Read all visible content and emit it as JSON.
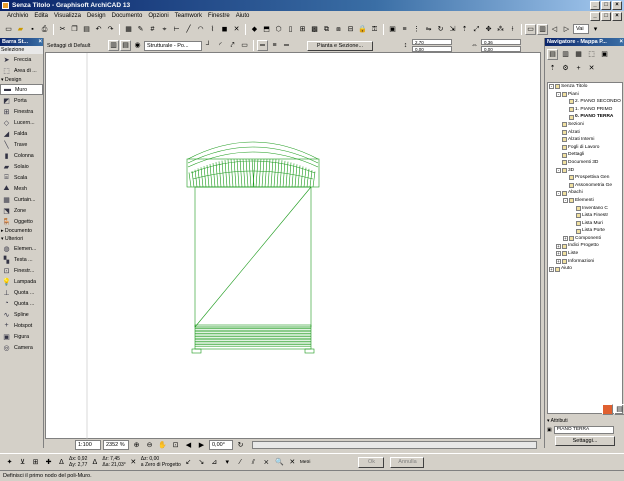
{
  "window": {
    "title": "Senza Titolo - Graphisoft ArchiCAD 13"
  },
  "menu": [
    "Archivio",
    "Edita",
    "Visualizza",
    "Design",
    "Documento",
    "Opzioni",
    "Teamwork",
    "Finestre",
    "Aiuto"
  ],
  "infobox": {
    "settings_label": "Settaggi di Default",
    "structure_select": "Strutturale - Po...",
    "plan_section_button": "Pianta e Sezione...",
    "val_1": "2,70",
    "val_2": "0,00",
    "val_3": "0,36",
    "val_4": "0,00",
    "layer_value": "Vai"
  },
  "toolbox": {
    "title": "Barra St...",
    "selection_label": "Selezione",
    "tools_top": [
      "Freccia",
      "Area di ..."
    ],
    "design_label": "Design",
    "design_tools": [
      "Muro",
      "Porta",
      "Finestra",
      "Lucern...",
      "Falda",
      "Trave",
      "Colonna",
      "Solaio",
      "Scala",
      "Mesh",
      "Curtain...",
      "Zone",
      "Oggetto"
    ],
    "document_label": "Documento",
    "more_label": "Ulteriori",
    "more_tools": [
      "Elemen...",
      "Testa ...",
      "Finestr...",
      "Lampada",
      "Quota ...",
      "Quota ...",
      "Spline",
      "Hotspot",
      "Figura",
      "Camera"
    ]
  },
  "navigator": {
    "title": "Navigatore - Mappa P...",
    "tree": [
      {
        "label": "Senza Titolo",
        "level": 0,
        "toggle": "-"
      },
      {
        "label": "Piani",
        "level": 1,
        "toggle": "-"
      },
      {
        "label": "2. PIANO SECONDO",
        "level": 2,
        "toggle": ""
      },
      {
        "label": "1. PIANO PRIMO",
        "level": 2,
        "toggle": ""
      },
      {
        "label": "0. PIANO TERRA",
        "level": 2,
        "toggle": "",
        "selected": true
      },
      {
        "label": "Sezioni",
        "level": 1,
        "toggle": ""
      },
      {
        "label": "Alzati",
        "level": 1,
        "toggle": ""
      },
      {
        "label": "Alzati Interni",
        "level": 1,
        "toggle": ""
      },
      {
        "label": "Fogli di Lavoro",
        "level": 1,
        "toggle": ""
      },
      {
        "label": "Dettagli",
        "level": 1,
        "toggle": ""
      },
      {
        "label": "Documenti 3D",
        "level": 1,
        "toggle": ""
      },
      {
        "label": "3D",
        "level": 1,
        "toggle": "-"
      },
      {
        "label": "Prospettiva Gen",
        "level": 2,
        "toggle": ""
      },
      {
        "label": "Assonometria Ge",
        "level": 2,
        "toggle": ""
      },
      {
        "label": "Abachi",
        "level": 1,
        "toggle": "-"
      },
      {
        "label": "Elementi",
        "level": 2,
        "toggle": "-"
      },
      {
        "label": "Inventano C",
        "level": 3,
        "toggle": ""
      },
      {
        "label": "Lista Finestr",
        "level": 3,
        "toggle": ""
      },
      {
        "label": "Lista Muri",
        "level": 3,
        "toggle": ""
      },
      {
        "label": "Lista Porte",
        "level": 3,
        "toggle": ""
      },
      {
        "label": "Componenti",
        "level": 2,
        "toggle": "+"
      },
      {
        "label": "Indici Progetto",
        "level": 1,
        "toggle": "+"
      },
      {
        "label": "Liste",
        "level": 1,
        "toggle": "+"
      },
      {
        "label": "Informazioni",
        "level": 1,
        "toggle": "+"
      },
      {
        "label": "Aiuto",
        "level": 0,
        "toggle": "+"
      }
    ],
    "attributes_label": "Attributi",
    "attr_field": "PIANO TERRA",
    "settings_button": "Settaggi..."
  },
  "view": {
    "scale": "1:100",
    "zoom": "2352 %",
    "angle": "0,00°"
  },
  "coords": {
    "dx": "0,92",
    "dy": "2,77",
    "angle_a": "7,45",
    "dist": "21,03°",
    "dz": "0,00",
    "ref": "a Zero di Progetto",
    "meter_label": "Metri"
  },
  "buttons": {
    "ok": "Ok",
    "cancel": "Annulla"
  },
  "status_hint": "Definisci il primo nodo del poli-Muro.",
  "colors": {
    "accent": "#0a246a",
    "drawing": "#1a9a1a"
  }
}
